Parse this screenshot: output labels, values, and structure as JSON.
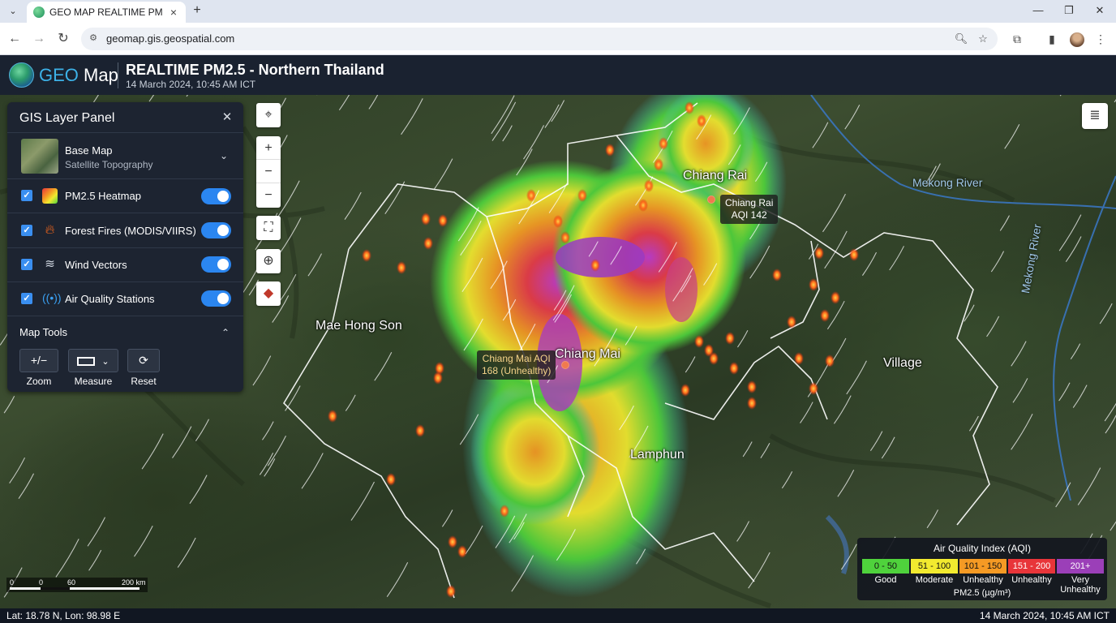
{
  "browser": {
    "tab_title": "GEO MAP REALTIME PM2.5 - Northern Thailand",
    "url": "geomap.gis.geospatial.com"
  },
  "header": {
    "logo_geo": "GEO",
    "logo_map": "Map",
    "title": "REALTIME PM2.5 - Northern Thailand",
    "subtitle": "14 March 2024, 10:45 AM ICT"
  },
  "panel": {
    "title": "GIS Layer Panel",
    "base_map": {
      "label": "Base Map",
      "value": "Satellite Topography"
    },
    "layers": [
      {
        "label": "PM2.5 Heatmap",
        "icon": "heatmap-icon",
        "checked": true,
        "on": true
      },
      {
        "label": "Forest Fires (MODIS/VIIRS)",
        "icon": "fire-icon",
        "checked": true,
        "on": true
      },
      {
        "label": "Wind Vectors",
        "icon": "wind-icon",
        "checked": true,
        "on": true
      },
      {
        "label": "Air Quality Stations",
        "icon": "antenna-icon",
        "checked": true,
        "on": true
      }
    ],
    "tools_title": "Map Tools",
    "tools": [
      {
        "button": "+/−",
        "caption": "Zoom"
      },
      {
        "button": "",
        "caption": "Measure"
      },
      {
        "button": "",
        "caption": "Reset"
      }
    ]
  },
  "map": {
    "cities": [
      "Chiang Rai",
      "Mae Hong Son",
      "Chiang Mai",
      "Lamphun",
      "Village"
    ],
    "rivers": [
      "Mekong River",
      "Mekong River"
    ],
    "callouts": [
      {
        "line1": "Chiang Rai",
        "line2": "AQI 142"
      },
      {
        "line1": "Chiang Mai AQI",
        "line2": "168 (Unhealthy)"
      }
    ],
    "scale": {
      "labels": [
        "0",
        "0",
        "60",
        "200 km"
      ]
    }
  },
  "legend": {
    "title": "Air Quality Index (AQI)",
    "unit": "PM2.5 (µg/m³)",
    "classes": [
      {
        "range": "0 - 50",
        "label": "Good",
        "color": "#4fd23c"
      },
      {
        "range": "51 - 100",
        "label": "Moderate",
        "color": "#f2ea2f"
      },
      {
        "range": "101 - 150",
        "label": "Unhealthy",
        "color": "#f59a24"
      },
      {
        "range": "151 - 200",
        "label": "Unhealthy",
        "color": "#e8353a"
      },
      {
        "range": "201+",
        "label": "Very Unhealthy",
        "color": "#9b3fb8"
      }
    ]
  },
  "status": {
    "coords": "Lat: 18.78 N, Lon: 98.98 E",
    "time": "14 March 2024, 10:45 AM ICT"
  }
}
